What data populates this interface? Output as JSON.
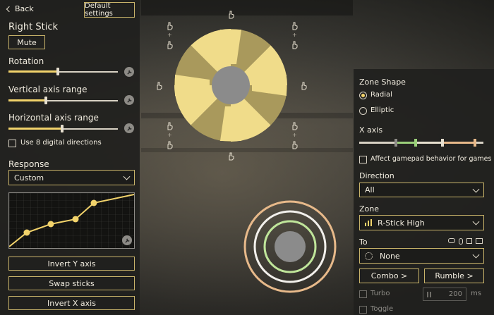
{
  "header": {
    "back_label": "Back",
    "default_settings_label": "Default settings"
  },
  "left": {
    "section_title": "Right Stick",
    "mute_label": "Mute",
    "rotation_label": "Rotation",
    "rotation_value": 0.42,
    "vertical_label": "Vertical axis range",
    "vertical_value": 0.31,
    "horizontal_label": "Horizontal axis range",
    "horizontal_value": 0.45,
    "digital_label": "Use 8 digital directions",
    "response_label": "Response",
    "response_value": "Custom",
    "invert_y_label": "Invert Y axis",
    "swap_label": "Swap sticks",
    "invert_x_label": "Invert X axis"
  },
  "right": {
    "zone_shape_label": "Zone Shape",
    "radial_label": "Radial",
    "elliptic_label": "Elliptic",
    "xaxis_label": "X axis",
    "affect_label": "Affect gamepad behavior for games",
    "direction_label": "Direction",
    "direction_value": "All",
    "zone_label": "Zone",
    "zone_value": "R-Stick High",
    "to_label": "To",
    "to_value": "None",
    "combo_label": "Combo >",
    "rumble_label": "Rumble >",
    "turbo_label": "Turbo",
    "turbo_value": "200",
    "turbo_unit": "ms",
    "toggle_label": "Toggle"
  },
  "colors": {
    "accent": "#f2d36b",
    "border": "#c8b36a",
    "panel": "#20201e"
  }
}
